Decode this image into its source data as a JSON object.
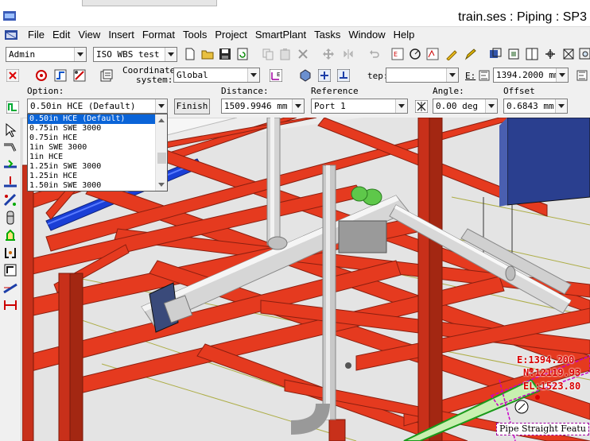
{
  "window": {
    "title": "train.ses : Piping : SP3"
  },
  "menu": [
    "File",
    "Edit",
    "View",
    "Insert",
    "Format",
    "Tools",
    "Project",
    "SmartPlant",
    "Tasks",
    "Window",
    "Help"
  ],
  "toolbar1": {
    "permission_group": "Admin",
    "wbs": "ISO WBS test"
  },
  "toolbar2": {
    "coordinate_label_1": "Coordinate",
    "coordinate_label_2": "system:",
    "coordinate_value": "Global",
    "step_label": "tep:",
    "step_value": "",
    "e_label": "E:",
    "e_value": "1394.2000 mm"
  },
  "toolbar3": {
    "option_label": "Option:",
    "option_value": "0.50in  HCE (Default)",
    "finish_label": "Finish",
    "distance_label": "Distance:",
    "distance_value": "1509.9946 mm",
    "reference_label": "Reference",
    "reference_value": "Port 1",
    "angle_label": "Angle:",
    "angle_value": "0.00 deg",
    "offset_label": "Offset",
    "offset_value": "0.6843 mm"
  },
  "option_list": [
    "0.50in  HCE (Default)",
    "0.75in  SWE  3000",
    "0.75in  HCE",
    "1in  SWE  3000",
    "1in  HCE",
    "1.25in  SWE  3000",
    "1.25in  HCE",
    "1.50in  SWE  3000"
  ],
  "option_selected_index": 0,
  "readouts": {
    "e": "E:1394.200",
    "n": "N:12119.93",
    "el": "EL:1523.80"
  },
  "tooltip": "Pipe Straight Featu",
  "colors": {
    "steel": "#e53a1f",
    "steel_dark": "#a32712",
    "pipe": "#dcdcdc",
    "blue_pipe": "#1a3fd6",
    "fitting": "#5ec84a",
    "selection": "#c800c8"
  }
}
